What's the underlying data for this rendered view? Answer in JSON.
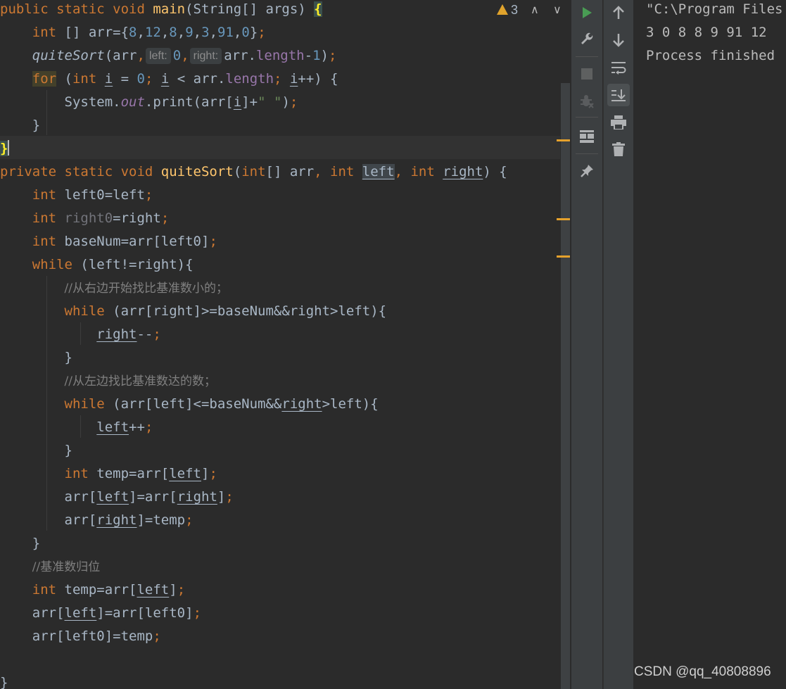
{
  "editor": {
    "warnings": {
      "count": "3"
    },
    "code_lines": [
      "public static void main(String[] args) {",
      "    int [] arr={8,12,8,9,3,91,0};",
      "    quiteSort(arr, left: 0, right: arr.length-1);",
      "    for (int i = 0; i < arr.length; i++) {",
      "        System.out.print(arr[i]+\" \");",
      "    }",
      "}",
      "private static void quiteSort(int[] arr, int left, int right) {",
      "    int left0=left;",
      "    int right0=right;",
      "    int baseNum=arr[left0];",
      "    while (left!=right){",
      "        //从右边开始找比基准数小的；",
      "        while (arr[right]>=baseNum&&right>left){",
      "            right--;",
      "        }",
      "        //从左边找比基准数达的数；",
      "        while (arr[left]<=baseNum&&right>left){",
      "            left++;",
      "        }",
      "        int temp=arr[left];",
      "        arr[left]=arr[right];",
      "        arr[right]=temp;",
      "    }",
      "    //基准数归位",
      "    int temp=arr[left];",
      "    arr[left]=arr[left0];",
      "    arr[left0]=temp;",
      "",
      "}"
    ]
  },
  "run_toolbar_left": [
    {
      "name": "rerun-icon",
      "color": "#499c54"
    },
    {
      "name": "wrench-icon"
    },
    {
      "name": "stop-icon"
    },
    {
      "name": "debug-bug-icon"
    },
    {
      "name": "layout-icon"
    },
    {
      "name": "pin-icon"
    }
  ],
  "run_toolbar_right": [
    {
      "name": "arrow-up-icon"
    },
    {
      "name": "arrow-down-icon"
    },
    {
      "name": "soft-wrap-icon"
    },
    {
      "name": "scroll-to-end-icon",
      "active": true
    },
    {
      "name": "print-icon"
    },
    {
      "name": "trash-icon"
    }
  ],
  "console": {
    "lines": [
      "\"C:\\Program Files",
      "3 0 8 8 9 91 12",
      "Process finished"
    ]
  },
  "watermark": "CSDN @qq_40808896",
  "colors": {
    "editor_bg": "#2b2b2b",
    "keyword": "#cc7832",
    "method": "#ffc66d",
    "number": "#6897bb",
    "string": "#6a8759",
    "field": "#9876aa",
    "comment": "#808080",
    "warning": "#e0a32c"
  }
}
